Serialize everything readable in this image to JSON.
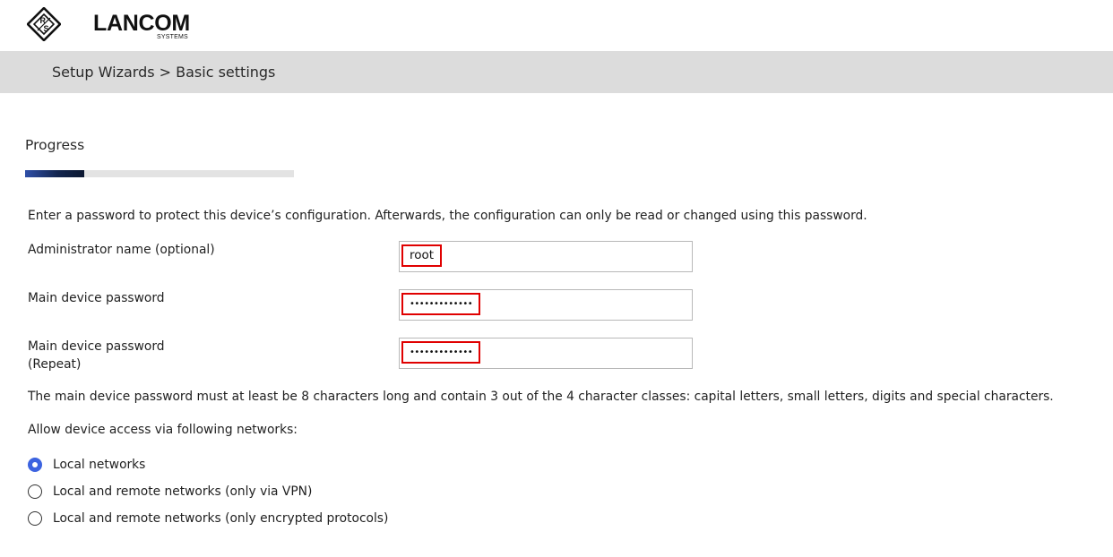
{
  "header": {
    "logo_text": "LANCOM",
    "logo_sub": "SYSTEMS",
    "logo_mark": "rs-diamond-logo"
  },
  "breadcrumb": "Setup Wizards > Basic settings",
  "progress": {
    "title": "Progress",
    "value_percent": 22
  },
  "intro_text": "Enter a password to protect this device’s configuration. Afterwards, the configuration can only be read or changed using this password.",
  "form": {
    "admin_name_label": "Administrator name (optional)",
    "admin_name_value": "root",
    "password_label": "Main device password",
    "password_value": "•••••••••••••",
    "password_repeat_label_1": "Main device password",
    "password_repeat_label_2": "(Repeat)",
    "password_repeat_value": "•••••••••••••"
  },
  "password_hint": "The main device password must at least be 8 characters long and contain 3 out of the 4 character classes: capital letters, small letters, digits and special characters.",
  "access": {
    "title": "Allow device access via following networks:",
    "options": [
      {
        "label": "Local networks",
        "checked": true
      },
      {
        "label": "Local and remote networks (only via VPN)",
        "checked": false
      },
      {
        "label": "Local and remote networks (only encrypted protocols)",
        "checked": false
      }
    ]
  },
  "colors": {
    "radio_checked": "#3c63e0",
    "highlight_border": "#e00000",
    "breadcrumb_bg": "#dcdcdc",
    "progress_fill": "#13254f"
  }
}
